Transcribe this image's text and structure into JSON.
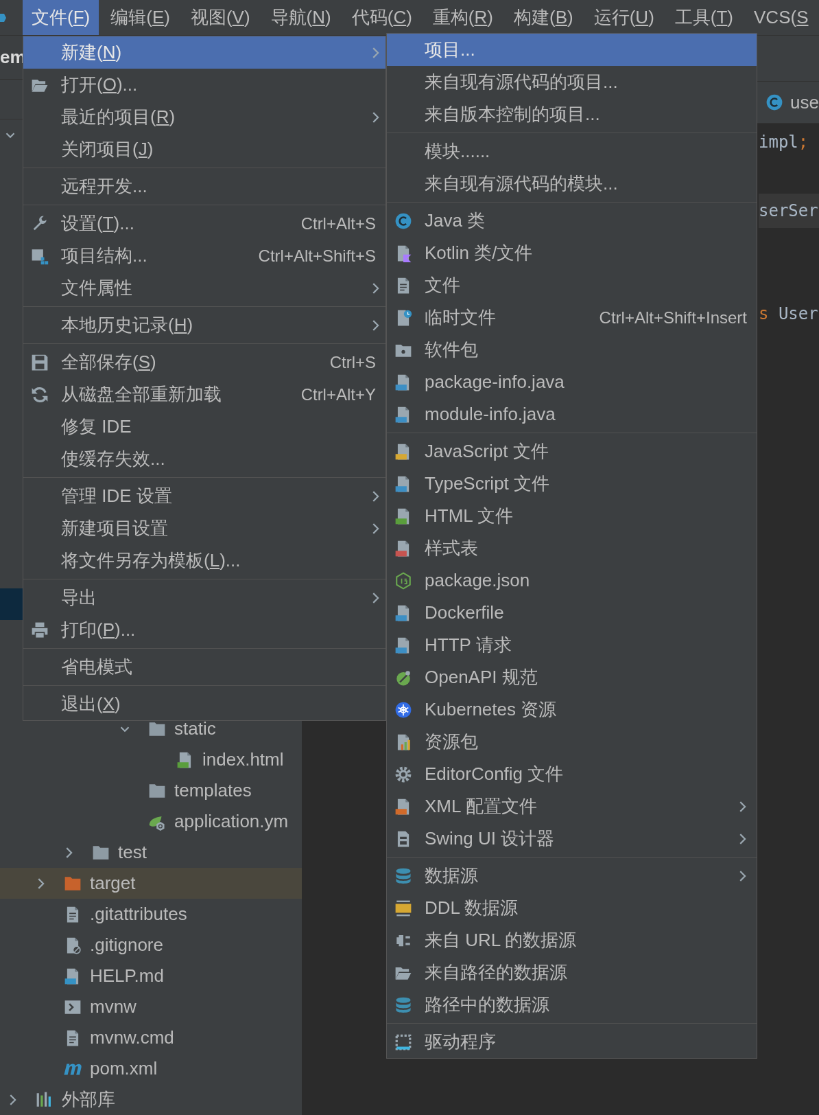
{
  "menu_bar": {
    "items": [
      {
        "label": [
          "文件(",
          "F",
          ")"
        ],
        "selected": true
      },
      {
        "label": [
          "编辑(",
          "E",
          ")"
        ],
        "selected": false
      },
      {
        "label": [
          "视图(",
          "V",
          ")"
        ],
        "selected": false
      },
      {
        "label": [
          "导航(",
          "N",
          ")"
        ],
        "selected": false
      },
      {
        "label": [
          "代码(",
          "C",
          ")"
        ],
        "selected": false
      },
      {
        "label": [
          "重构(",
          "R",
          ")"
        ],
        "selected": false
      },
      {
        "label": [
          "构建(",
          "B",
          ")"
        ],
        "selected": false
      },
      {
        "label": [
          "运行(",
          "U",
          ")"
        ],
        "selected": false
      },
      {
        "label": [
          "工具(",
          "T",
          ")"
        ],
        "selected": false
      },
      {
        "label": [
          "VCS(",
          "S"
        ],
        "selected": false
      }
    ]
  },
  "file_menu": {
    "groups": [
      [
        {
          "label": [
            "新建(",
            "N",
            ")"
          ],
          "submenu": true,
          "selected": true
        },
        {
          "label": [
            "打开(",
            "O",
            ")..."
          ],
          "kind": "folder-open",
          "submenu": false,
          "selected": false
        },
        {
          "label": [
            "最近的项目(",
            "R",
            ")"
          ],
          "submenu": true,
          "selected": false
        },
        {
          "label": [
            "关闭项目(",
            "J",
            ")"
          ],
          "submenu": false,
          "selected": false
        }
      ],
      [
        {
          "label": "远程开发...",
          "submenu": false,
          "selected": false
        }
      ],
      [
        {
          "label": [
            "设置(",
            "T",
            ")..."
          ],
          "kind": "wrench",
          "shortcut": "Ctrl+Alt+S",
          "submenu": false,
          "selected": false
        },
        {
          "label": "项目结构...",
          "kind": "structure",
          "shortcut": "Ctrl+Alt+Shift+S",
          "submenu": false,
          "selected": false
        },
        {
          "label": "文件属性",
          "submenu": true,
          "selected": false
        }
      ],
      [
        {
          "label": [
            "本地历史记录(",
            "H",
            ")"
          ],
          "submenu": true,
          "selected": false
        }
      ],
      [
        {
          "label": [
            "全部保存(",
            "S",
            ")"
          ],
          "kind": "save",
          "shortcut": "Ctrl+S",
          "submenu": false,
          "selected": false
        },
        {
          "label": "从磁盘全部重新加载",
          "kind": "reload",
          "shortcut": "Ctrl+Alt+Y",
          "submenu": false,
          "selected": false
        },
        {
          "label": "修复 IDE",
          "submenu": false,
          "selected": false
        },
        {
          "label": "使缓存失效...",
          "submenu": false,
          "selected": false
        }
      ],
      [
        {
          "label": "管理 IDE 设置",
          "submenu": true,
          "selected": false
        },
        {
          "label": "新建项目设置",
          "submenu": true,
          "selected": false
        },
        {
          "label": [
            "将文件另存为模板(",
            "L",
            ")..."
          ],
          "submenu": false,
          "selected": false
        }
      ],
      [
        {
          "label": "导出",
          "submenu": true,
          "selected": false
        },
        {
          "label": [
            "打印(",
            "P",
            ")..."
          ],
          "kind": "printer",
          "submenu": false,
          "selected": false
        }
      ],
      [
        {
          "label": "省电模式",
          "submenu": false,
          "selected": false
        }
      ],
      [
        {
          "label": [
            "退出(",
            "X",
            ")"
          ],
          "submenu": false,
          "selected": false
        }
      ]
    ]
  },
  "new_submenu": {
    "groups": [
      [
        {
          "label": "项目...",
          "submenu": false,
          "selected": true
        },
        {
          "label": "来自现有源代码的项目...",
          "submenu": false,
          "selected": false
        },
        {
          "label": "来自版本控制的项目...",
          "submenu": false,
          "selected": false
        }
      ],
      [
        {
          "label": "模块......",
          "submenu": false,
          "selected": false
        },
        {
          "label": "来自现有源代码的模块...",
          "submenu": false,
          "selected": false
        }
      ],
      [
        {
          "label": "Java 类",
          "kind": "class",
          "submenu": false,
          "selected": false
        },
        {
          "label": "Kotlin 类/文件",
          "kind": "kotlin",
          "submenu": false,
          "selected": false
        },
        {
          "label": "文件",
          "kind": "file",
          "submenu": false,
          "selected": false
        },
        {
          "label": "临时文件",
          "kind": "scratch",
          "shortcut": "Ctrl+Alt+Shift+Insert",
          "submenu": false,
          "selected": false
        },
        {
          "label": "软件包",
          "kind": "package",
          "submenu": false,
          "selected": false
        },
        {
          "label": "package-info.java",
          "kind": "java-file",
          "submenu": false,
          "selected": false
        },
        {
          "label": "module-info.java",
          "kind": "java-file",
          "submenu": false,
          "selected": false
        }
      ],
      [
        {
          "label": "JavaScript 文件",
          "kind": "js",
          "submenu": false,
          "selected": false
        },
        {
          "label": "TypeScript 文件",
          "kind": "ts",
          "submenu": false,
          "selected": false
        },
        {
          "label": "HTML 文件",
          "kind": "html",
          "submenu": false,
          "selected": false
        },
        {
          "label": "样式表",
          "kind": "css",
          "submenu": false,
          "selected": false
        },
        {
          "label": "package.json",
          "kind": "node",
          "submenu": false,
          "selected": false
        },
        {
          "label": "Dockerfile",
          "kind": "docker",
          "submenu": false,
          "selected": false
        },
        {
          "label": "HTTP 请求",
          "kind": "http",
          "submenu": false,
          "selected": false
        },
        {
          "label": "OpenAPI 规范",
          "kind": "openapi",
          "submenu": false,
          "selected": false
        },
        {
          "label": "Kubernetes 资源",
          "kind": "kubernetes",
          "submenu": false,
          "selected": false
        },
        {
          "label": "资源包",
          "kind": "bundle",
          "submenu": false,
          "selected": false
        },
        {
          "label": "EditorConfig 文件",
          "kind": "gear",
          "submenu": false,
          "selected": false
        },
        {
          "label": "XML 配置文件",
          "kind": "xml",
          "submenu": true,
          "selected": false
        },
        {
          "label": "Swing UI 设计器",
          "kind": "form",
          "submenu": true,
          "selected": false
        }
      ],
      [
        {
          "label": "数据源",
          "kind": "database",
          "submenu": true,
          "selected": false
        },
        {
          "label": "DDL 数据源",
          "kind": "ddl",
          "submenu": false,
          "selected": false
        },
        {
          "label": "来自 URL 的数据源",
          "kind": "plug",
          "submenu": false,
          "selected": false
        },
        {
          "label": "来自路径的数据源",
          "kind": "folder-open",
          "submenu": false,
          "selected": false
        },
        {
          "label": "路径中的数据源",
          "kind": "database",
          "submenu": false,
          "selected": false
        }
      ],
      [
        {
          "label": "驱动程序",
          "kind": "driver",
          "submenu": false,
          "selected": false
        }
      ]
    ]
  },
  "project_panel": {
    "title": "em",
    "covered_rows": [
      {
        "expanded": true,
        "selected": false
      },
      {
        "selected": true
      }
    ],
    "tree": [
      {
        "children": [
          {
            "children": [
              {
                "children": [
                  {
                    "children": [
                      {
                        "label": "static",
                        "kind": "folder",
                        "expanded": true,
                        "selected": false,
                        "children": [
                          {
                            "label": "index.html",
                            "kind": "html",
                            "selected": false
                          }
                        ]
                      },
                      {
                        "label": "templates",
                        "kind": "folder",
                        "selected": false
                      },
                      {
                        "label": "application.ym",
                        "kind": "spring",
                        "selected": false
                      }
                    ]
                  }
                ]
              },
              {
                "label": "test",
                "kind": "folder",
                "expanded": false,
                "selected": false
              }
            ]
          },
          {
            "label": "target",
            "kind": "excluded-folder",
            "expanded": false,
            "selected": true
          },
          {
            "label": ".gitattributes",
            "kind": "text",
            "selected": false
          },
          {
            "label": ".gitignore",
            "kind": "ignore",
            "selected": false
          },
          {
            "label": "HELP.md",
            "kind": "markdown",
            "selected": false
          },
          {
            "label": "mvnw",
            "kind": "script",
            "selected": false
          },
          {
            "label": "mvnw.cmd",
            "kind": "text",
            "selected": false
          },
          {
            "label": "pom.xml",
            "kind": "maven",
            "selected": false
          }
        ]
      },
      {
        "label": "外部库",
        "kind": "library",
        "expanded": false,
        "selected": false
      }
    ]
  },
  "editor": {
    "tab": {
      "label": "use",
      "kind": "class"
    },
    "lines": [
      {
        "segments": [
          {
            "text": "impl",
            "kind": "plain"
          },
          {
            "text": ";",
            "kind": "keyword"
          }
        ],
        "current": false
      },
      {
        "current": false
      },
      {
        "segments": [
          {
            "text": "serSer",
            "kind": "plain"
          }
        ],
        "current": true
      },
      {
        "current": false
      },
      {
        "current": false
      },
      {
        "segments": [
          {
            "text": "s",
            "kind": "keyword"
          },
          {
            "text": " User",
            "kind": "plain"
          }
        ],
        "current": false
      }
    ]
  }
}
